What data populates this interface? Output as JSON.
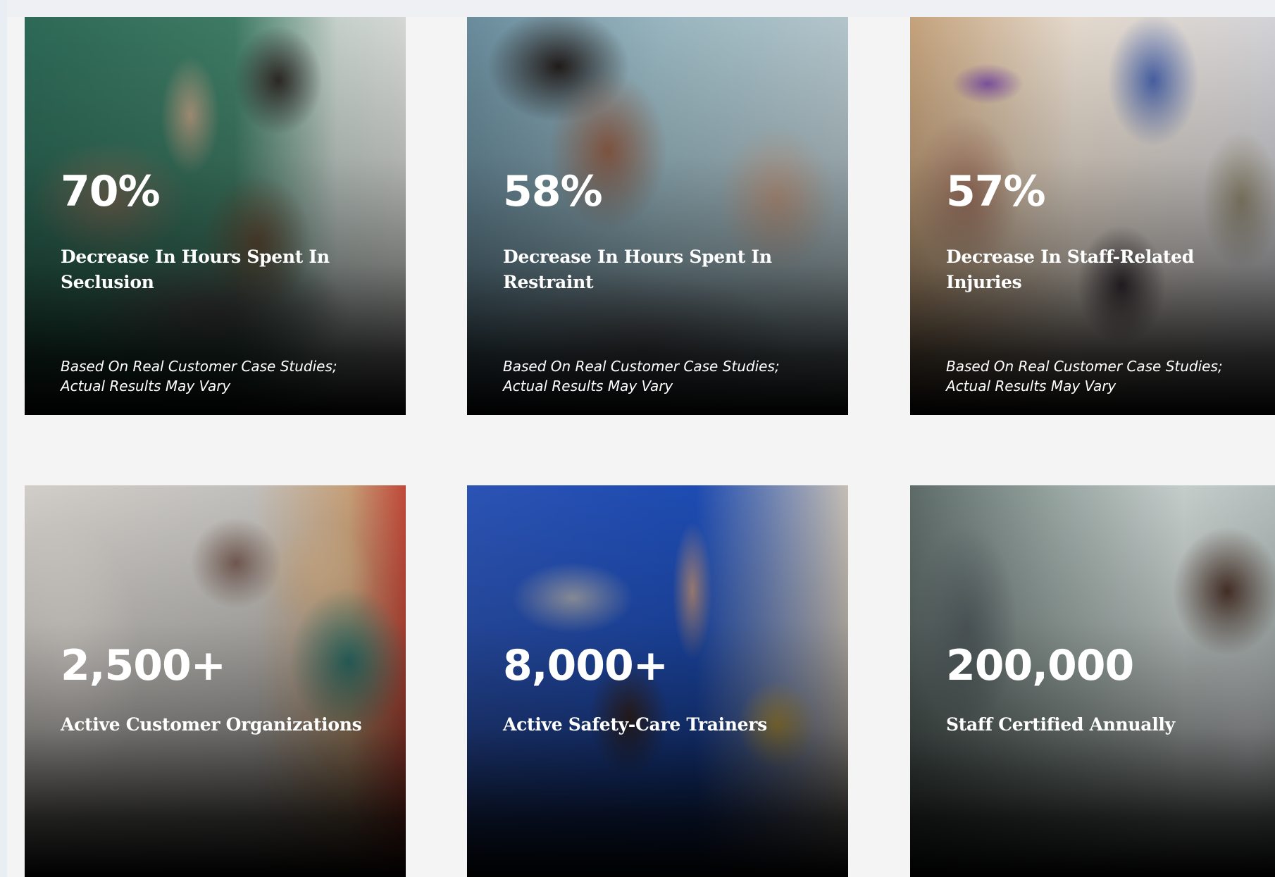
{
  "stats": [
    {
      "value": "70%",
      "label": "Decrease In Hours Spent In Seclusion",
      "note": "Based On Real Customer Case Studies; Actual Results May Vary"
    },
    {
      "value": "58%",
      "label": "Decrease In Hours Spent In Restraint",
      "note": "Based On Real Customer Case Studies; Actual Results May Vary"
    },
    {
      "value": "57%",
      "label": "Decrease In Staff-Related Injuries",
      "note": "Based On Real Customer Case Studies; Actual Results May Vary"
    },
    {
      "value": "2,500+",
      "label": "Active Customer Organizations"
    },
    {
      "value": "8,000+",
      "label": "Active Safety-Care Trainers"
    },
    {
      "value": "200,000",
      "label": "Staff Certified Annually"
    }
  ],
  "colors": {
    "page_background": "#f4f4f4",
    "text": "#ffffff"
  }
}
